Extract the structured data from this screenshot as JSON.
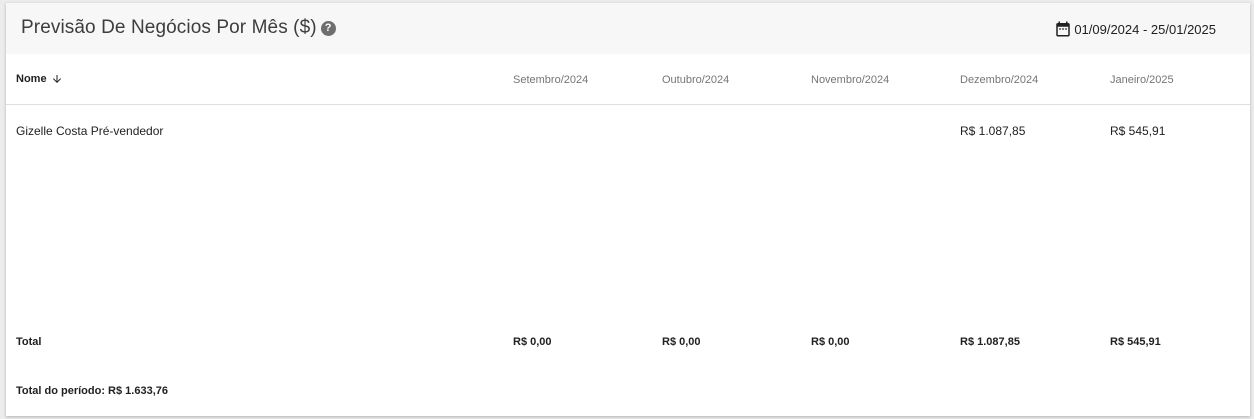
{
  "header": {
    "title": "Previsão De Negócios Por Mês ($)",
    "help_icon": "help-circle-icon",
    "date_range": "01/09/2024 - 25/01/2025",
    "calendar_icon": "calendar-icon"
  },
  "table": {
    "name_header": "Nome",
    "sort_icon": "arrow-down-icon",
    "months": [
      "Setembro/2024",
      "Outubro/2024",
      "Novembro/2024",
      "Dezembro/2024",
      "Janeiro/2025"
    ],
    "rows": [
      {
        "name": "Gizelle Costa Pré-vendedor",
        "values": [
          "",
          "",
          "",
          "R$ 1.087,85",
          "R$ 545,91"
        ]
      }
    ],
    "total_label": "Total",
    "totals": [
      "R$ 0,00",
      "R$ 0,00",
      "R$ 0,00",
      "R$ 1.087,85",
      "R$ 545,91"
    ]
  },
  "footer": {
    "period_total": "Total do período: R$ 1.633,76"
  }
}
